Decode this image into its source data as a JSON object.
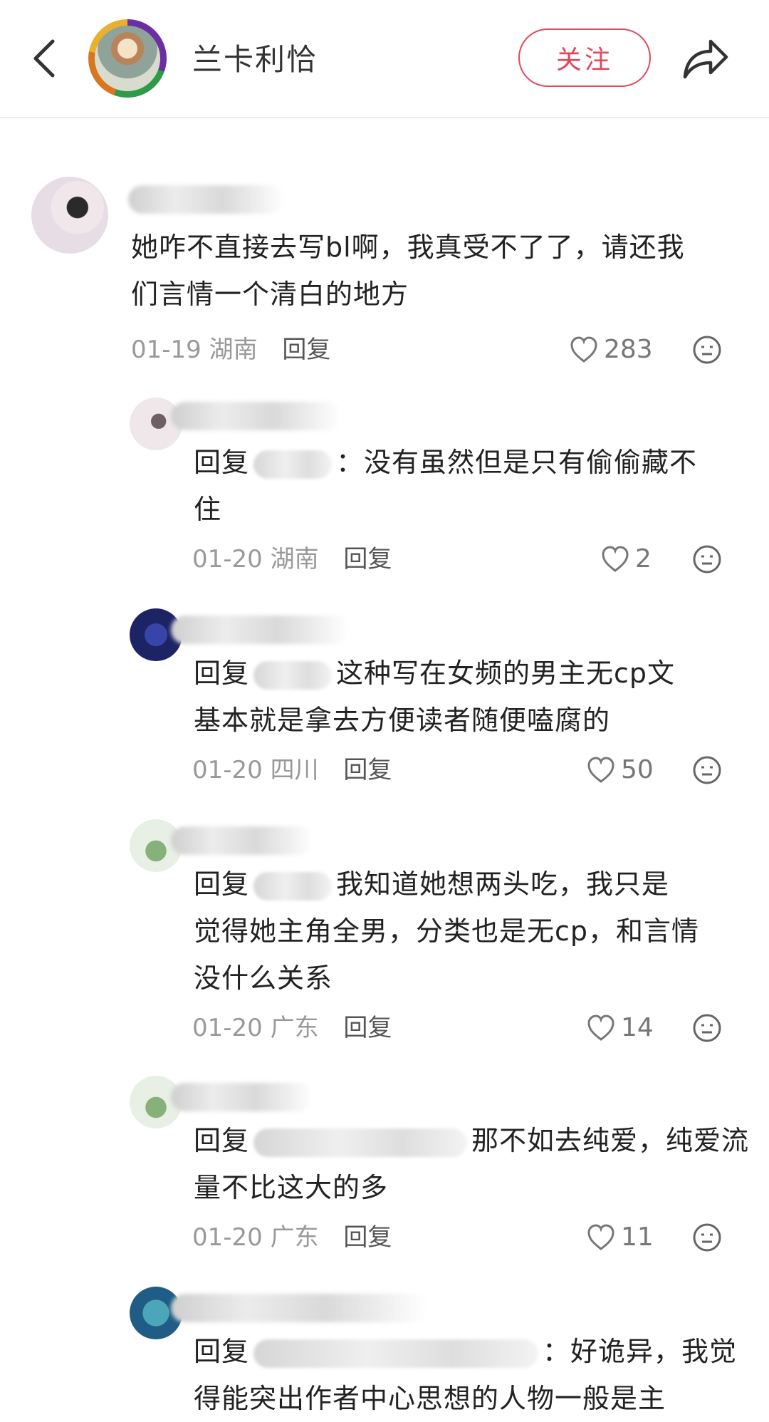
{
  "header": {
    "author_name": "兰卡利恰",
    "follow_label": "关注"
  },
  "comments": [
    {
      "text": "她咋不直接去写bl啊，我真受不了了，请还我们言情一个清白的地方",
      "line1": "她咋不直接去写bl啊，我真受不了了，请还我",
      "line2": "们言情一个清白的地方",
      "date": "01-19",
      "region": "湖南",
      "reply_label": "回复",
      "likes": "283"
    }
  ],
  "replies": [
    {
      "prefix": "回复",
      "line1": "：没有虽然但是只有偷偷藏不",
      "line2": "住",
      "date": "01-20",
      "region": "湖南",
      "reply_label": "回复",
      "likes": "2"
    },
    {
      "prefix": "回复",
      "line1": "这种写在女频的男主无cp文",
      "line2": "基本就是拿去方便读者随便嗑腐的",
      "date": "01-20",
      "region": "四川",
      "reply_label": "回复",
      "likes": "50"
    },
    {
      "prefix": "回复",
      "line1": "我知道她想两头吃，我只是",
      "line2": "觉得她主角全男，分类也是无cp，和言情",
      "line3": "没什么关系",
      "date": "01-20",
      "region": "广东",
      "reply_label": "回复",
      "likes": "14"
    },
    {
      "prefix": "回复",
      "line1": "那不如去纯爱，纯爱流",
      "line2": "量不比这大的多",
      "date": "01-20",
      "region": "广东",
      "reply_label": "回复",
      "likes": "11"
    },
    {
      "prefix": "回复",
      "line1": "：好诡异，我觉",
      "line2": "得能突出作者中心思想的人物一般是主"
    }
  ]
}
